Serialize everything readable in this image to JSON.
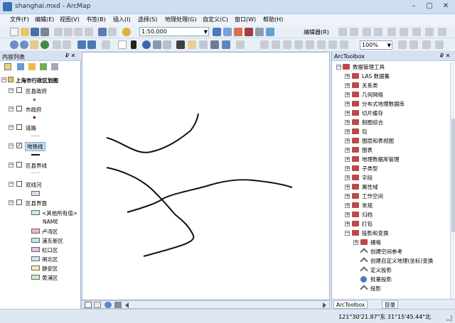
{
  "window": {
    "title": "shanghai.mxd - ArcMap",
    "controls": [
      "–",
      "□",
      "✕"
    ]
  },
  "menu": [
    "文件(F)",
    "编辑(E)",
    "视图(V)",
    "书签(B)",
    "插入(I)",
    "选择(S)",
    "地理处理(G)",
    "自定义(C)",
    "窗口(W)",
    "帮助(H)"
  ],
  "toolbar": {
    "scale": "1:50,000",
    "editor_label": "编辑器(R)",
    "zoom": "100%"
  },
  "toc": {
    "title": "内容列表",
    "ctrl": "₽ ✕",
    "root": "上海市行政区划图",
    "layers": [
      {
        "name": "区县政府",
        "checked": false,
        "symbol": "dot"
      },
      {
        "name": "市政府",
        "checked": false,
        "symbol": "diamond"
      },
      {
        "name": "道路",
        "checked": false,
        "symbol": "line-light"
      },
      {
        "name": "地铁线",
        "checked": true,
        "symbol": "line-dark",
        "selected": true
      },
      {
        "name": "区县界线",
        "checked": false,
        "symbol": "line-dash"
      },
      {
        "name": "双线河",
        "checked": false,
        "symbol": "fill-lavender"
      },
      {
        "name": "区县界面",
        "checked": false,
        "symbol": "none"
      }
    ],
    "legend_items": [
      {
        "label": "<其他所有值>",
        "color": "#c8eedc"
      },
      {
        "label": "NAME",
        "color": ""
      },
      {
        "label": "卢湾区",
        "color": "#f2b4b8"
      },
      {
        "label": "浦东新区",
        "color": "#bfe8f0"
      },
      {
        "label": "虹口区",
        "color": "#d8c4f2"
      },
      {
        "label": "闸北区",
        "color": "#cfe2f8"
      },
      {
        "label": "静安区",
        "color": "#f6f0b8"
      },
      {
        "label": "黄浦区",
        "color": "#c9f0c0"
      }
    ]
  },
  "toolbox": {
    "title": "ArcToolbox",
    "ctrl": "₽ ✕",
    "root": "数据管理工具",
    "items": [
      "LAS 数据集",
      "关系类",
      "几何网络",
      "分布式地理数据库",
      "切片缓存",
      "制图综合",
      "包",
      "图层和表视图",
      "图表",
      "地理数据库管理",
      "子类型",
      "字段",
      "属性域",
      "工作空间",
      "常规",
      "归档",
      "打包",
      "投影和变换"
    ],
    "sub_items": [
      "栅格",
      "创建空间参考",
      "创建自定义地理(坐标)变换",
      "定义投影",
      "批量投影",
      "投影"
    ],
    "tabs": [
      "ArcToolbox",
      "目录"
    ]
  },
  "status": {
    "coords": "121°30'21.87\"东  31°15'45.44\"北"
  }
}
